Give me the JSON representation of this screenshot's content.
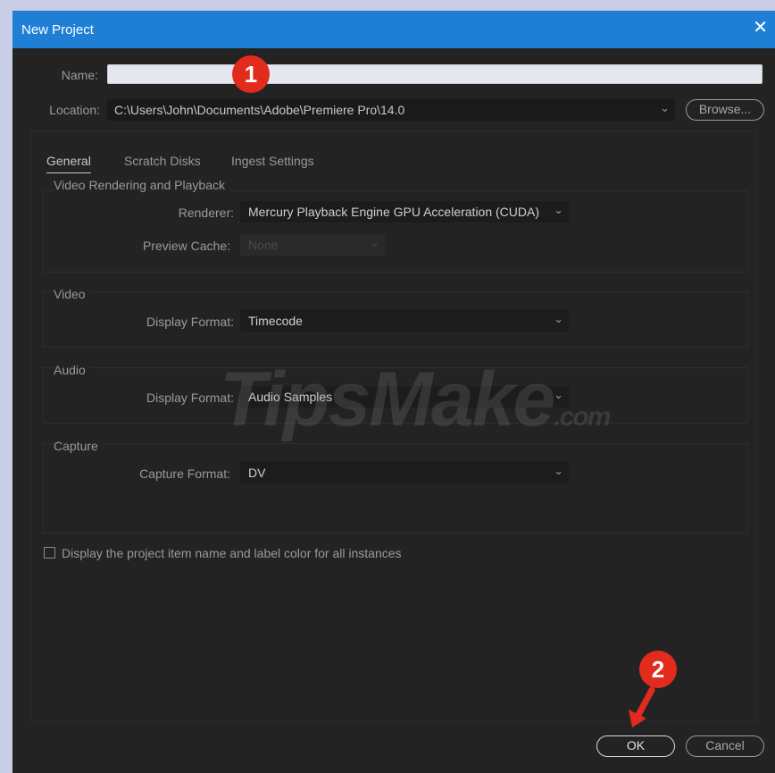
{
  "dialog": {
    "title": "New Project",
    "close_glyph": "✕"
  },
  "form": {
    "name_label": "Name:",
    "name_value": "",
    "location_label": "Location:",
    "location_value": "C:\\Users\\John\\Documents\\Adobe\\Premiere Pro\\14.0",
    "browse_label": "Browse..."
  },
  "tabs": [
    {
      "label": "General",
      "active": true
    },
    {
      "label": "Scratch Disks",
      "active": false
    },
    {
      "label": "Ingest Settings",
      "active": false
    }
  ],
  "groups": {
    "video_rendering": {
      "title": "Video Rendering and Playback",
      "renderer_label": "Renderer:",
      "renderer_value": "Mercury Playback Engine GPU Acceleration (CUDA)",
      "preview_cache_label": "Preview Cache:",
      "preview_cache_value": "None"
    },
    "video": {
      "title": "Video",
      "display_format_label": "Display Format:",
      "display_format_value": "Timecode"
    },
    "audio": {
      "title": "Audio",
      "display_format_label": "Display Format:",
      "display_format_value": "Audio Samples"
    },
    "capture": {
      "title": "Capture",
      "capture_format_label": "Capture Format:",
      "capture_format_value": "DV"
    }
  },
  "checkbox": {
    "label": "Display the project item name and label color for all instances",
    "checked": false
  },
  "buttons": {
    "ok": "OK",
    "cancel": "Cancel"
  },
  "annotations": {
    "step1": "1",
    "step2": "2"
  },
  "watermark": {
    "text": "TipsMake",
    "suffix": ".com"
  },
  "colors": {
    "titlebar": "#1f7fd4",
    "dialog_bg": "#232323",
    "badge": "#e22b1c"
  },
  "icons": {
    "chevron": "chevron-down-icon",
    "close": "close-icon"
  }
}
